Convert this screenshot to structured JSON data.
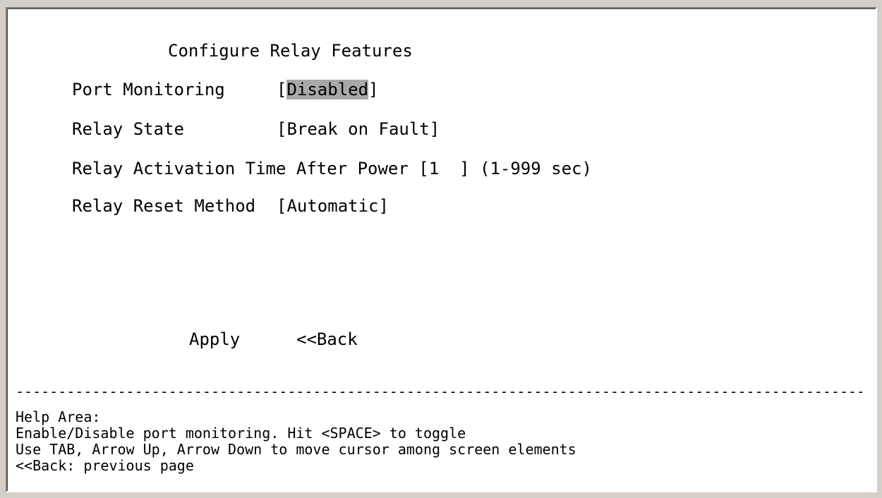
{
  "screen": {
    "title": "Configure Relay Features"
  },
  "fields": {
    "port_monitoring": {
      "label": "Port Monitoring",
      "open": "[",
      "value": "Disabled",
      "close": "]"
    },
    "relay_state": {
      "label": "Relay State",
      "value": "[Break on Fault]"
    },
    "relay_activation": {
      "label": "Relay Activation Time After Power",
      "open": "[",
      "value": "1  ",
      "close": "]",
      "hint": "(1-999 sec)"
    },
    "relay_reset": {
      "label": "Relay Reset Method",
      "value": "[Automatic]"
    }
  },
  "buttons": {
    "apply": "Apply",
    "back": "<<Back"
  },
  "divider": "----------------------------------------------------------------------------------------------------------------",
  "help": {
    "title": "Help Area:",
    "line1": "Enable/Disable port monitoring. Hit <SPACE> to toggle",
    "line2": "Use TAB, Arrow Up, Arrow Down to move cursor among screen elements",
    "line3": "<<Back: previous page"
  }
}
